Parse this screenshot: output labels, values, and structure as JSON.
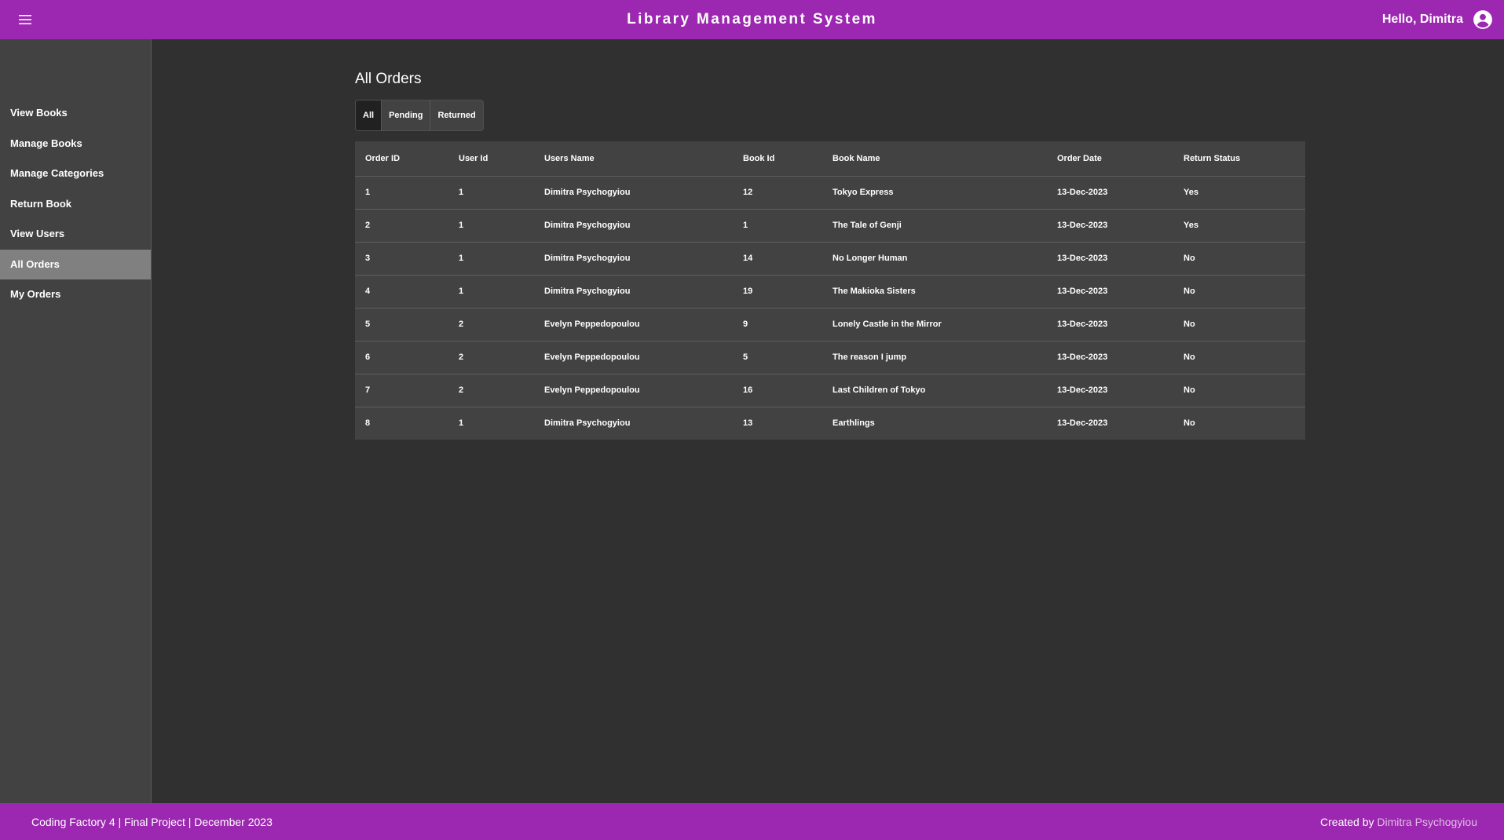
{
  "header": {
    "title": "Library Management System",
    "greeting": "Hello, Dimitra",
    "menu_icon": "hamburger-menu-icon",
    "account_icon": "account-circle-icon",
    "brand_color": "#9c27b0"
  },
  "sidebar": {
    "items": [
      {
        "label": "View Books",
        "active": false
      },
      {
        "label": "Manage Books",
        "active": false
      },
      {
        "label": "Manage Categories",
        "active": false
      },
      {
        "label": "Return Book",
        "active": false
      },
      {
        "label": "View Users",
        "active": false
      },
      {
        "label": "All Orders",
        "active": true
      },
      {
        "label": "My Orders",
        "active": false
      }
    ]
  },
  "main": {
    "title": "All Orders",
    "filters": [
      {
        "label": "All",
        "active": true
      },
      {
        "label": "Pending",
        "active": false
      },
      {
        "label": "Returned",
        "active": false
      }
    ],
    "table": {
      "columns": [
        "Order ID",
        "User Id",
        "Users Name",
        "Book Id",
        "Book Name",
        "Order Date",
        "Return Status"
      ],
      "rows": [
        [
          "1",
          "1",
          "Dimitra Psychogyiou",
          "12",
          "Tokyo Express",
          "13-Dec-2023",
          "Yes"
        ],
        [
          "2",
          "1",
          "Dimitra Psychogyiou",
          "1",
          "The Tale of Genji",
          "13-Dec-2023",
          "Yes"
        ],
        [
          "3",
          "1",
          "Dimitra Psychogyiou",
          "14",
          "No Longer Human",
          "13-Dec-2023",
          "No"
        ],
        [
          "4",
          "1",
          "Dimitra Psychogyiou",
          "19",
          "The Makioka Sisters",
          "13-Dec-2023",
          "No"
        ],
        [
          "5",
          "2",
          "Evelyn Peppedopoulou",
          "9",
          "Lonely Castle in the Mirror",
          "13-Dec-2023",
          "No"
        ],
        [
          "6",
          "2",
          "Evelyn Peppedopoulou",
          "5",
          "The reason I jump",
          "13-Dec-2023",
          "No"
        ],
        [
          "7",
          "2",
          "Evelyn Peppedopoulou",
          "16",
          "Last Children of Tokyo",
          "13-Dec-2023",
          "No"
        ],
        [
          "8",
          "1",
          "Dimitra Psychogyiou",
          "13",
          "Earthlings",
          "13-Dec-2023",
          "No"
        ]
      ]
    }
  },
  "footer": {
    "left_text": "Coding Factory 4 | Final Project | December 2023",
    "created_by_label": "Created by",
    "author": "Dimitra Psychogyiou"
  }
}
